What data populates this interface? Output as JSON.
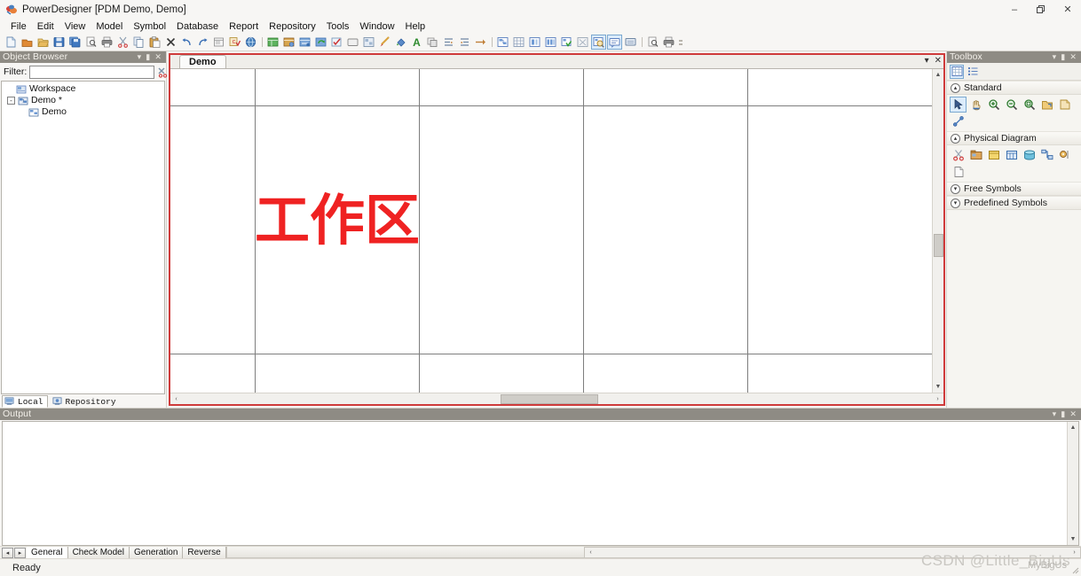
{
  "window": {
    "title": "PowerDesigner [PDM Demo, Demo]",
    "app_icon": "powerdesigner-icon",
    "minimize": "–",
    "maximize": "❐",
    "close": "✕"
  },
  "menubar": {
    "items": [
      {
        "label": "File"
      },
      {
        "label": "Edit"
      },
      {
        "label": "View"
      },
      {
        "label": "Model"
      },
      {
        "label": "Symbol"
      },
      {
        "label": "Database"
      },
      {
        "label": "Report"
      },
      {
        "label": "Repository"
      },
      {
        "label": "Tools"
      },
      {
        "label": "Window"
      },
      {
        "label": "Help"
      }
    ]
  },
  "toolbar": {
    "groups": [
      {
        "name": "standard",
        "buttons": [
          {
            "icon": "new-document-icon",
            "color": "#e9eef5",
            "accent": "#8aa9cc"
          },
          {
            "icon": "new-model-icon",
            "color": "#c8742a",
            "accent": "#f0a65a"
          },
          {
            "icon": "open-folder-icon",
            "color": "#d9a441",
            "accent": "#f2c978"
          },
          {
            "icon": "save-icon",
            "color": "#2f67b5",
            "accent": "#78a3de"
          },
          {
            "icon": "save-all-icon",
            "color": "#2f67b5",
            "accent": "#5f8fd1"
          },
          {
            "icon": "print-preview-icon",
            "color": "#dcdcdc",
            "accent": "#9a9a9a"
          },
          {
            "icon": "print-icon",
            "color": "#6b6b6b",
            "accent": "#b9b9b9"
          },
          {
            "icon": "cut-icon",
            "color": "#9aa7b5",
            "accent": "#d04040"
          },
          {
            "icon": "copy-icon",
            "color": "#c9d4e2",
            "accent": "#7d93ad"
          },
          {
            "icon": "paste-icon",
            "color": "#d7a24b",
            "accent": "#8c5c20"
          },
          {
            "icon": "delete-icon",
            "color": "#2b2b2b",
            "accent": "#2b2b2b"
          },
          {
            "icon": "undo-icon",
            "color": "#3a6fb5",
            "accent": "#3a6fb5"
          },
          {
            "icon": "redo-icon",
            "color": "#3a6fb5",
            "accent": "#3a6fb5"
          },
          {
            "icon": "properties-icon",
            "color": "#e3e3e3",
            "accent": "#8a8a8a"
          },
          {
            "icon": "check-model-icon",
            "color": "#d9a441",
            "accent": "#cc3333"
          },
          {
            "icon": "globe-icon",
            "color": "#3f6fa8",
            "accent": "#6fa3d8"
          }
        ]
      },
      {
        "name": "model-objects",
        "buttons": [
          {
            "icon": "new-table-icon",
            "color": "#4e9f4e",
            "accent": "#9ed79e"
          },
          {
            "icon": "new-view-icon",
            "color": "#d7a24b",
            "accent": "#8c5c20"
          },
          {
            "icon": "new-reference-icon",
            "color": "#6f9fd0",
            "accent": "#3f6fa8"
          },
          {
            "icon": "refresh-model-icon",
            "color": "#5b8fd0",
            "accent": "#3aa03a"
          },
          {
            "icon": "validate-icon",
            "color": "#e6eef8",
            "accent": "#cc3333"
          },
          {
            "icon": "package-icon",
            "color": "#e8e8e8",
            "accent": "#9a9a9a"
          },
          {
            "icon": "layout-icon",
            "color": "#cfd9e6",
            "accent": "#6f87a3"
          },
          {
            "icon": "format-brush-icon",
            "color": "#d9a441",
            "accent": "#c0392b"
          },
          {
            "icon": "fill-color-icon",
            "color": "#3f6fa8",
            "accent": "#3fa83f"
          },
          {
            "icon": "text-style-icon",
            "color": "#2e8b2e",
            "accent": "#2e8b2e"
          },
          {
            "icon": "group-icon",
            "color": "#dcdcdc",
            "accent": "#8a8a8a"
          },
          {
            "icon": "align-left-icon",
            "color": "#6f87a3",
            "accent": "#c0803a"
          },
          {
            "icon": "align-right-icon",
            "color": "#6f87a3",
            "accent": "#c0803a"
          },
          {
            "icon": "arrange-icon",
            "color": "#c0803a",
            "accent": "#6f87a3"
          }
        ]
      },
      {
        "name": "diagram-views",
        "buttons": [
          {
            "icon": "physical-diagram-icon",
            "color": "#5b7fbf",
            "accent": "#ffffff"
          },
          {
            "icon": "multidimensional-diagram-icon",
            "color": "#8a9db8",
            "accent": "#ffffff"
          },
          {
            "icon": "business-process-icon",
            "color": "#5b7fbf",
            "accent": "#ffffff"
          },
          {
            "icon": "data-movement-icon",
            "color": "#5b7fbf",
            "accent": "#ffffff"
          },
          {
            "icon": "new-diagram-icon",
            "color": "#5b7fbf",
            "accent": "#3aa03a"
          },
          {
            "icon": "dependency-matrix-icon",
            "color": "#9aa7b5",
            "accent": "#ffffff"
          },
          {
            "icon": "zoom-diagram-icon",
            "color": "#5b7fbf",
            "accent": "#d9a441",
            "selected": true
          },
          {
            "icon": "comment-icon",
            "color": "#ffffff",
            "accent": "#5b7fbf",
            "selected": true
          },
          {
            "icon": "note-icon",
            "color": "#c9d4e2",
            "accent": "#6f87a3"
          }
        ]
      },
      {
        "name": "print-group",
        "buttons": [
          {
            "icon": "page-preview-icon",
            "color": "#dcdcdc",
            "accent": "#9a9a9a"
          },
          {
            "icon": "print-diagram-icon",
            "color": "#6b6b6b",
            "accent": "#b9b9b9"
          }
        ]
      }
    ]
  },
  "object_browser": {
    "title": "Object Browser",
    "collapse_icon": "▾",
    "pin_icon": "▮",
    "close_icon": "✕",
    "filter_label": "Filter:",
    "filter_value": "",
    "filter_placeholder": "",
    "filter_clear_icon": "clear-filter-icon",
    "filter_refresh_icon": "refresh-filter-icon",
    "tree": [
      {
        "label": "Workspace",
        "level": 0,
        "icon": "workspace-icon",
        "expander": ""
      },
      {
        "label": "Demo *",
        "level": 1,
        "icon": "model-icon",
        "expander": "-"
      },
      {
        "label": "Demo",
        "level": 2,
        "icon": "diagram-icon",
        "expander": ""
      }
    ],
    "tabs": [
      {
        "label": "Local",
        "icon": "local-icon",
        "active": true
      },
      {
        "label": "Repository",
        "icon": "repository-icon",
        "active": false
      }
    ]
  },
  "editor": {
    "tabs": [
      {
        "label": "Demo",
        "active": true
      }
    ],
    "tab_menu_icon": "▾",
    "tab_close_icon": "✕",
    "canvas": {
      "annotation": "工作区",
      "annotation_color": "#ef2222",
      "v_gridlines": [
        95,
        280,
        465,
        650
      ],
      "h_gridlines": [
        41,
        321
      ],
      "scroll_up_icon": "▲",
      "scroll_down_icon": "▼",
      "scroll_left_icon": "‹",
      "scroll_right_icon": "›"
    }
  },
  "toolbox": {
    "title": "Toolbox",
    "collapse_icon": "▾",
    "pin_icon": "▮",
    "close_icon": "✕",
    "view_buttons": [
      {
        "icon": "grid-view-icon",
        "selected": true
      },
      {
        "icon": "list-view-icon",
        "selected": false
      }
    ],
    "groups": [
      {
        "name": "Standard",
        "expanded": true,
        "chevron": "▴",
        "items": [
          {
            "icon": "pointer-icon",
            "selected": true,
            "color": "#3a5a8c"
          },
          {
            "icon": "grabber-hand-icon",
            "selected": false,
            "color": "#d9a441"
          },
          {
            "icon": "zoom-in-icon",
            "selected": false,
            "color": "#3f8f3f"
          },
          {
            "icon": "zoom-out-icon",
            "selected": false,
            "color": "#3f8f3f"
          },
          {
            "icon": "zoom-area-icon",
            "selected": false,
            "color": "#3f8f3f"
          },
          {
            "icon": "open-package-icon",
            "selected": false,
            "color": "#d9a441"
          },
          {
            "icon": "note-symbol-icon",
            "selected": false,
            "color": "#d9a441"
          },
          {
            "icon": "link-symbol-icon",
            "selected": false,
            "color": "#5b7fbf"
          }
        ]
      },
      {
        "name": "Physical Diagram",
        "expanded": true,
        "chevron": "▴",
        "items": [
          {
            "icon": "scissors-icon",
            "selected": false,
            "color": "#cc3333"
          },
          {
            "icon": "package-symbol-icon",
            "selected": false,
            "color": "#c0803a"
          },
          {
            "icon": "table-symbol-icon",
            "selected": false,
            "color": "#e8c45a"
          },
          {
            "icon": "view-symbol-icon",
            "selected": false,
            "color": "#5b7fbf"
          },
          {
            "icon": "database-symbol-icon",
            "selected": false,
            "color": "#4fa8c8"
          },
          {
            "icon": "reference-symbol-icon",
            "selected": false,
            "color": "#5b7fbf"
          },
          {
            "icon": "procedure-symbol-icon",
            "selected": false,
            "color": "#d9a441"
          },
          {
            "icon": "file-symbol-icon",
            "selected": false,
            "color": "#dcdcdc"
          }
        ]
      },
      {
        "name": "Free Symbols",
        "expanded": false,
        "chevron": "▾",
        "items": []
      },
      {
        "name": "Predefined Symbols",
        "expanded": false,
        "chevron": "▾",
        "items": []
      }
    ]
  },
  "output": {
    "title": "Output",
    "collapse_icon": "▾",
    "pin_icon": "▮",
    "close_icon": "✕",
    "content": "",
    "nav_prev": "◂",
    "nav_next": "▸",
    "tabs": [
      {
        "label": "General",
        "active": true
      },
      {
        "label": "Check Model",
        "active": false
      },
      {
        "label": "Generation",
        "active": false
      },
      {
        "label": "Reverse",
        "active": false
      }
    ],
    "scroll_left_icon": "‹",
    "scroll_right_icon": "›",
    "scroll_up_icon": "▲",
    "scroll_down_icon": "▼"
  },
  "statusbar": {
    "message": "Ready"
  },
  "watermark": {
    "text": "CSDN @Little_BigUs",
    "overlay": "MyBigUs"
  }
}
